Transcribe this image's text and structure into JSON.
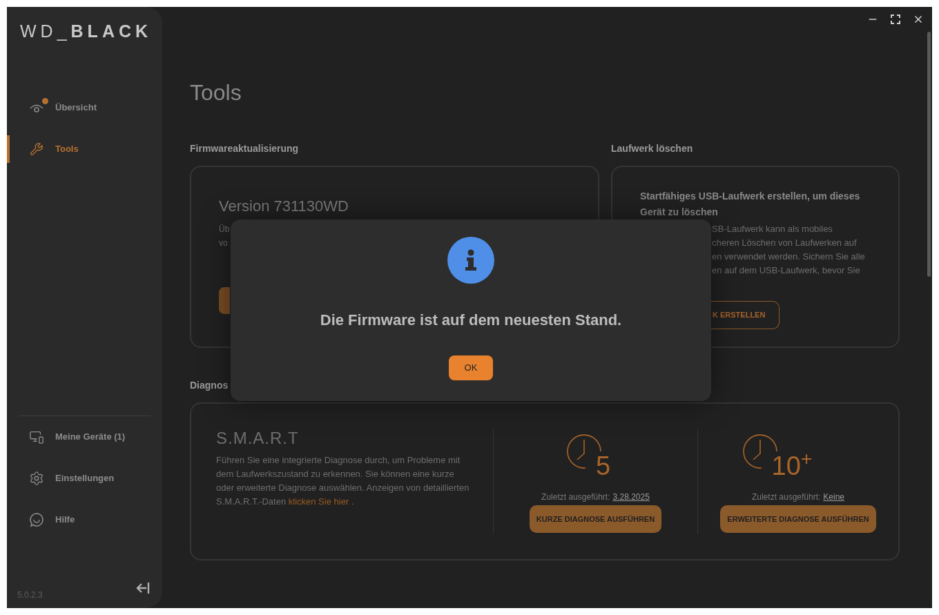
{
  "sidebar": {
    "logo": {
      "light": "WD_",
      "bold": "BLACK"
    },
    "nav": [
      {
        "label": "Übersicht",
        "selected": false,
        "notification": true
      },
      {
        "label": "Tools",
        "selected": true,
        "notification": false
      }
    ],
    "bottom_nav": [
      {
        "label": "Meine Geräte (1)"
      },
      {
        "label": "Einstellungen"
      },
      {
        "label": "Hilfe"
      }
    ],
    "version": "5.0.2.3"
  },
  "main": {
    "title": "Tools",
    "firmware": {
      "heading": "Firmwareaktualisierung",
      "version": "Version 731130WD",
      "text_lines": [
        "Üb",
        "vo"
      ]
    },
    "erase": {
      "heading": "Laufwerk löschen",
      "title": "Startfähiges USB-Laufwerk erstellen, um dieses Gerät zu löschen",
      "text_lines": [
        "SB-Laufwerk kann als mobiles",
        "cheren Löschen von Laufwerken auf",
        "en verwendet werden. Sichern Sie alle",
        "en auf dem USB-Laufwerk, bevor Sie"
      ],
      "button": "K ERSTELLEN"
    },
    "diagnostics": {
      "heading": "Diagnos",
      "smart": {
        "title": "S.M.A.R.T",
        "text": "Führen Sie eine integrierte Diagnose durch, um Probleme mit dem Laufwerkszustand zu erkennen. Sie können eine kurze oder erweiterte Diagnose auswählen. Anzeigen von detaillierten S.M.A.R.T.-Daten",
        "link": "klicken Sie hier",
        "after": "."
      },
      "tests": [
        {
          "duration": "5",
          "last_run_label": "Zuletzt ausgeführt:",
          "last_run": "3.28.2025",
          "button": "KURZE DIAGNOSE AUSFÜHREN"
        },
        {
          "duration": "10$^{+}$",
          "last_run_label": "Zuletzt ausgeführt:",
          "last_run": "Keine",
          "button": "ERWEITERTE DIAGNOSE AUSFÜHREN"
        }
      ]
    }
  },
  "dialog": {
    "message": "Die Firmware ist auf dem neuesten Stand.",
    "button": "OK"
  }
}
